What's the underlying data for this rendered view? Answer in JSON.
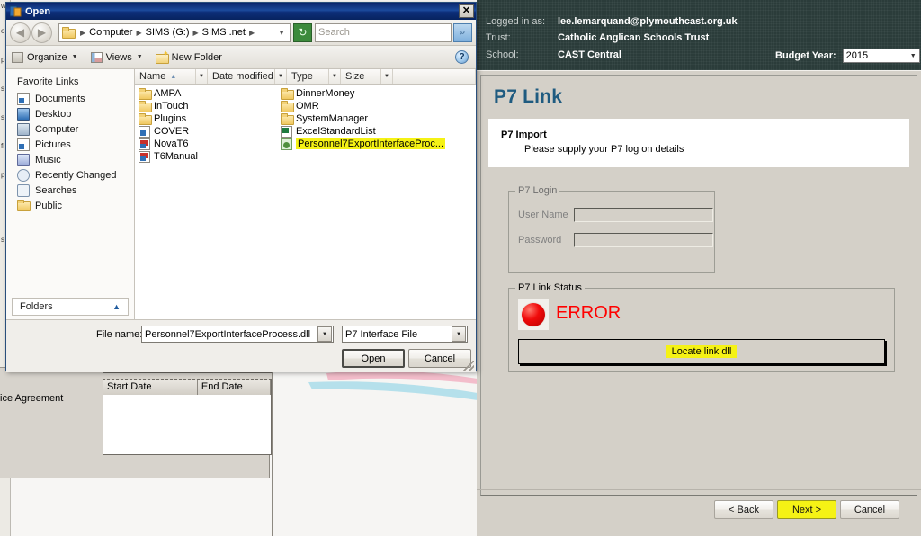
{
  "background_app": {
    "header": {
      "logged_in_label": "Logged in as:",
      "logged_in_value": "lee.lemarquand@plymouthcast.org.uk",
      "trust_label": "Trust:",
      "trust_value": "Catholic  Anglican Schools Trust",
      "school_label": "School:",
      "school_value": "CAST Central",
      "budget_year_label": "Budget Year:",
      "budget_year_value": "2015"
    },
    "page_title": "P7 Link",
    "banner": {
      "title": "P7 Import",
      "subtitle": "Please supply your P7 log on details"
    },
    "login_group": {
      "legend": "P7 Login",
      "username_label": "User Name",
      "username_value": "",
      "password_label": "Password",
      "password_value": ""
    },
    "status_group": {
      "legend": "P7 Link Status",
      "status_text": "ERROR",
      "status_color": "#ff0000",
      "locate_button_label": "Locate link dll"
    },
    "wizard_buttons": {
      "back": "< Back",
      "next": "Next >",
      "cancel": "Cancel"
    },
    "colors": {
      "header_bg": "#2b3c3a",
      "title_blue": "#1f5b80",
      "highlight_yellow": "#f5f215"
    }
  },
  "background_form": {
    "label": "ice Agreement",
    "grid_columns": [
      "Start Date",
      "End Date"
    ],
    "grid_rows": []
  },
  "open_dialog": {
    "title": "Open",
    "title_icon": "app-icon",
    "close_label": "✕",
    "nav": {
      "back_icon": "◀",
      "forward_icon": "▶",
      "breadcrumb": [
        "Computer",
        "SIMS (G:)",
        "SIMS .net"
      ],
      "breadcrumb_dropdown_icon": "▼",
      "refresh_icon": "↻",
      "search_placeholder": "Search",
      "search_value": "",
      "search_go_icon": "⌕"
    },
    "toolbar": {
      "organize": "Organize",
      "views": "Views",
      "new_folder": "New Folder",
      "help": "?"
    },
    "favorites": {
      "title": "Favorite Links",
      "items": [
        {
          "label": "Documents",
          "icon": "documents-icon"
        },
        {
          "label": "Desktop",
          "icon": "desktop-icon"
        },
        {
          "label": "Computer",
          "icon": "computer-icon"
        },
        {
          "label": "Pictures",
          "icon": "pictures-icon"
        },
        {
          "label": "Music",
          "icon": "music-icon"
        },
        {
          "label": "Recently Changed",
          "icon": "recently-changed-icon"
        },
        {
          "label": "Searches",
          "icon": "searches-icon"
        },
        {
          "label": "Public",
          "icon": "public-folder-icon"
        }
      ],
      "folders_label": "Folders",
      "folders_chevron": "▲"
    },
    "columns": [
      {
        "label": "Name",
        "sorted": "▲"
      },
      {
        "label": "Date modified",
        "sorted": ""
      },
      {
        "label": "Type",
        "sorted": ""
      },
      {
        "label": "Size",
        "sorted": ""
      }
    ],
    "files_column_1": [
      {
        "name": "AMPA",
        "icon": "folder-icon",
        "highlighted": false
      },
      {
        "name": "InTouch",
        "icon": "folder-icon",
        "highlighted": false
      },
      {
        "name": "Plugins",
        "icon": "folder-icon",
        "highlighted": false
      },
      {
        "name": "COVER",
        "icon": "shortcut-icon",
        "highlighted": false
      },
      {
        "name": "NovaT6",
        "icon": "app-red-icon",
        "highlighted": false
      },
      {
        "name": "T6Manual",
        "icon": "app-red-icon",
        "highlighted": false
      }
    ],
    "files_column_2": [
      {
        "name": "DinnerMoney",
        "icon": "folder-icon",
        "highlighted": false
      },
      {
        "name": "OMR",
        "icon": "folder-icon",
        "highlighted": false
      },
      {
        "name": "SystemManager",
        "icon": "folder-icon",
        "highlighted": false
      },
      {
        "name": "ExcelStandardList",
        "icon": "excel-icon",
        "highlighted": false
      },
      {
        "name": "Personnel7ExportInterfaceProc...",
        "icon": "dll-icon",
        "highlighted": true
      }
    ],
    "footer": {
      "file_name_label": "File name:",
      "file_name_value": "Personnel7ExportInterfaceProcess.dll",
      "file_type_value": "P7 Interface File",
      "open_button": "Open",
      "cancel_button": "Cancel",
      "combo_arrow": "▼"
    }
  }
}
